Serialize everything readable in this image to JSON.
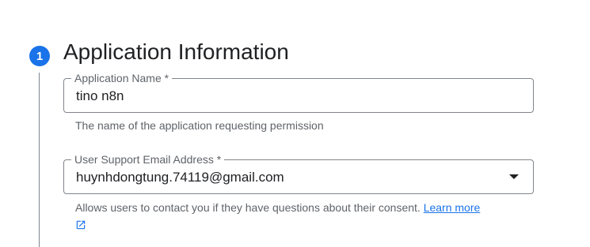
{
  "step": {
    "number": "1",
    "title": "Application Information"
  },
  "app_name_field": {
    "label": "Application Name *",
    "value": "tino n8n",
    "hint": "The name of the application requesting permission"
  },
  "support_email_field": {
    "label": "User Support Email Address *",
    "value": "huynhdongtung.74119@gmail.com",
    "hint": "Allows users to contact you if they have questions about their consent.",
    "link_text": "Learn more",
    "link_icon": "open-in-new-icon"
  },
  "colors": {
    "accent": "#1a73e8",
    "text_primary": "#202124",
    "text_secondary": "#5f6368",
    "border": "#80868b"
  }
}
